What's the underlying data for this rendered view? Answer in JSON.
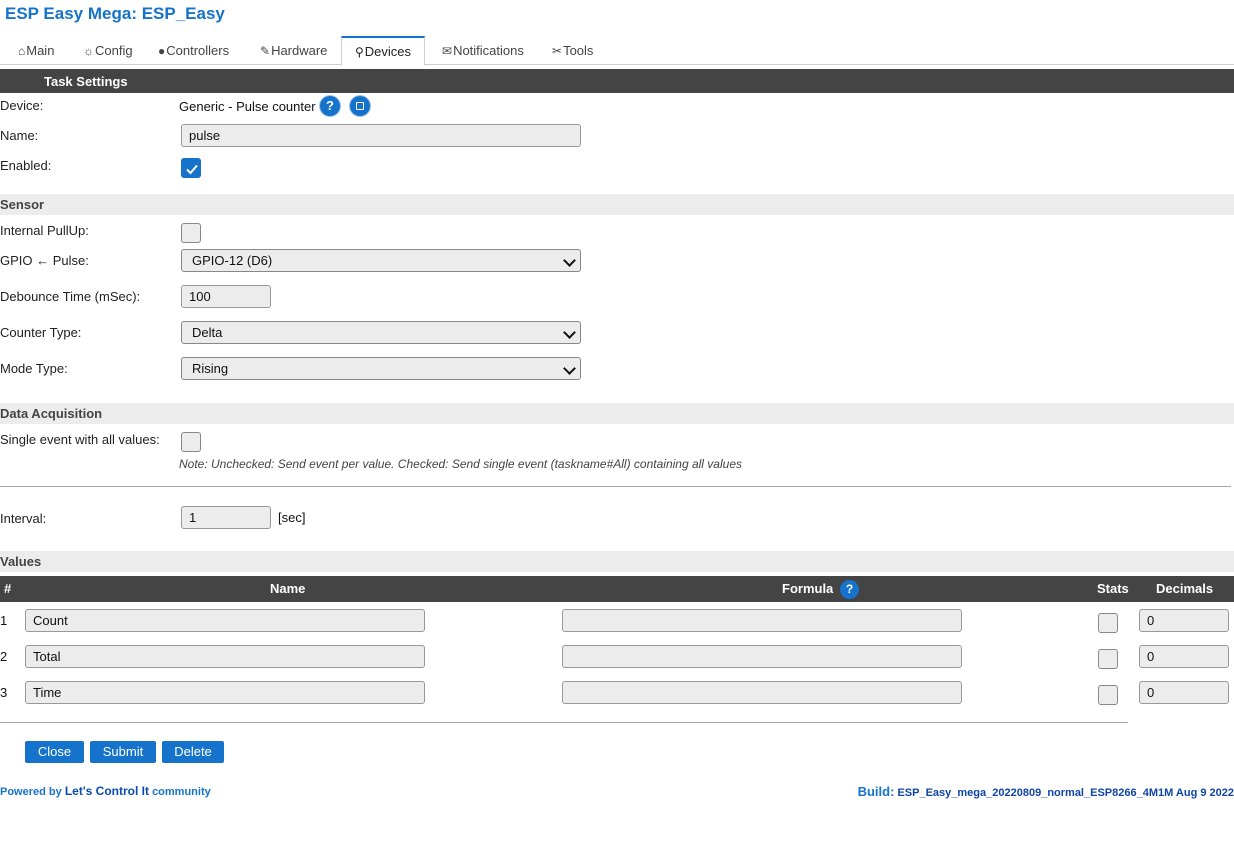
{
  "app_title": "ESP Easy Mega: ESP_Easy",
  "tabs": [
    {
      "icon": "⌂",
      "label": "Main"
    },
    {
      "icon": "☼",
      "label": "Config"
    },
    {
      "icon": "●",
      "label": "Controllers"
    },
    {
      "icon": "✎",
      "label": "Hardware"
    },
    {
      "icon": "⚲",
      "label": "Devices"
    },
    {
      "icon": "✉",
      "label": "Notifications"
    },
    {
      "icon": "✂",
      "label": "Tools"
    }
  ],
  "task_settings": {
    "header": "Task Settings",
    "device_label": "Device:",
    "device_value": "Generic - Pulse counter",
    "name_label": "Name:",
    "name_value": "pulse",
    "enabled_label": "Enabled:",
    "enabled": true
  },
  "sensor": {
    "header": "Sensor",
    "pullup_label": "Internal PullUp:",
    "pullup": false,
    "gpio_label": "GPIO ← Pulse:",
    "gpio_value": "GPIO-12 (D6)",
    "debounce_label": "Debounce Time (mSec):",
    "debounce_value": "100",
    "counter_label": "Counter Type:",
    "counter_value": "Delta",
    "mode_label": "Mode Type:",
    "mode_value": "Rising"
  },
  "data_acquisition": {
    "header": "Data Acquisition",
    "single_event_label": "Single event with all values:",
    "single_event": false,
    "note": "Note: Unchecked: Send event per value. Checked: Send single event (taskname#All) containing all values",
    "interval_label": "Interval:",
    "interval_value": "1",
    "interval_unit": "[sec]"
  },
  "values": {
    "header": "Values",
    "columns": {
      "num": "#",
      "name": "Name",
      "formula": "Formula",
      "stats": "Stats",
      "decimals": "Decimals"
    },
    "rows": [
      {
        "num": "1",
        "name": "Count",
        "formula": "",
        "stats": false,
        "decimals": "0"
      },
      {
        "num": "2",
        "name": "Total",
        "formula": "",
        "stats": false,
        "decimals": "0"
      },
      {
        "num": "3",
        "name": "Time",
        "formula": "",
        "stats": false,
        "decimals": "0"
      }
    ]
  },
  "buttons": {
    "close": "Close",
    "submit": "Submit",
    "delete": "Delete"
  },
  "footer": {
    "powered_prefix": "Powered by",
    "powered_link": "Let's Control It",
    "powered_suffix": "community",
    "build_label": "Build:",
    "build_value": "ESP_Easy_mega_20220809_normal_ESP8266_4M1M Aug 9 2022"
  },
  "colors": {
    "accent": "#1673cc",
    "header_dark": "#444444",
    "section_light": "#ececec"
  }
}
